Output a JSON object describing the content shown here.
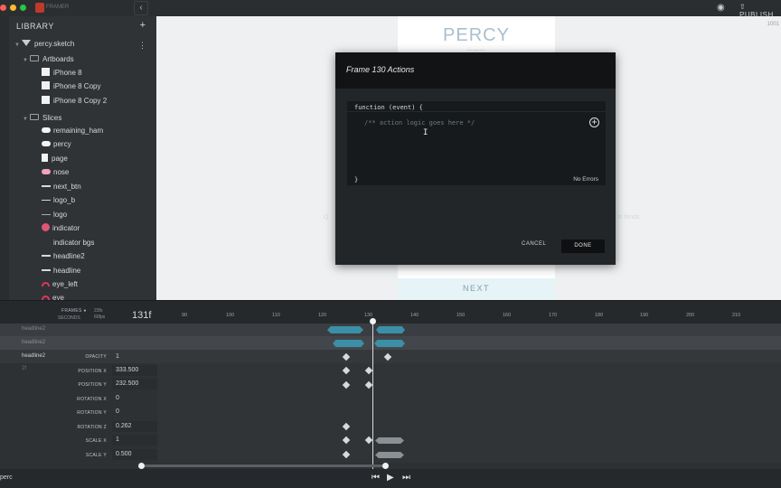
{
  "topbar": {
    "app_name": "FRAMER",
    "collapse_icon": "chevron-left",
    "preview_icon": "eye",
    "publish_label": "PUBLISH",
    "traffic_light_colors": [
      "#ff5f57",
      "#febc2e",
      "#28c840"
    ]
  },
  "library": {
    "title": "LIBRARY",
    "add_icon": "+",
    "file": "percy.sketch",
    "artboards_label": "Artboards",
    "artboards": [
      "iPhone 8",
      "iPhone 8 Copy",
      "iPhone 8 Copy 2"
    ],
    "slices_label": "Slices",
    "slices": [
      "remaining_ham",
      "percy",
      "page",
      "nose",
      "next_btn",
      "logo_b",
      "logo",
      "indicator",
      "indicator bgs",
      "headline2",
      "headline",
      "eye_left",
      "eye"
    ]
  },
  "canvas": {
    "brand": "PERCY",
    "next_label": "NEXT",
    "ghost_left": "Q",
    "ghost_right": "st fonds",
    "corner": "1001"
  },
  "modal": {
    "title": "Frame 130 Actions",
    "code_open": "function (event) {",
    "code_comment": "/** action logic goes here */",
    "code_close": "}",
    "status": "No Errors",
    "cancel_label": "CANCEL",
    "done_label": "DONE"
  },
  "timeline": {
    "frames_label": "FRAMES",
    "seconds_label": "SECONDS",
    "fps_line1": "23fs",
    "fps_line2": "60fps",
    "current_frame": "131f",
    "ruler": [
      "90",
      "100",
      "110",
      "120",
      "130",
      "140",
      "150",
      "160",
      "170",
      "180",
      "190",
      "200",
      "210"
    ],
    "layers": [
      "headline2",
      "headline2",
      "headline2",
      "2f"
    ],
    "properties": [
      {
        "name": "OPACITY",
        "value": "1"
      },
      {
        "name": "POSITION X",
        "value": "333.500"
      },
      {
        "name": "POSITION Y",
        "value": "232.500"
      },
      {
        "name": "ROTATION X",
        "value": "0"
      },
      {
        "name": "ROTATION Y",
        "value": "0"
      },
      {
        "name": "ROTATION Z",
        "value": "0.262"
      },
      {
        "name": "SCALE X",
        "value": "1"
      },
      {
        "name": "SCALE Y",
        "value": "0.500"
      }
    ],
    "bottom_name": "perc"
  }
}
